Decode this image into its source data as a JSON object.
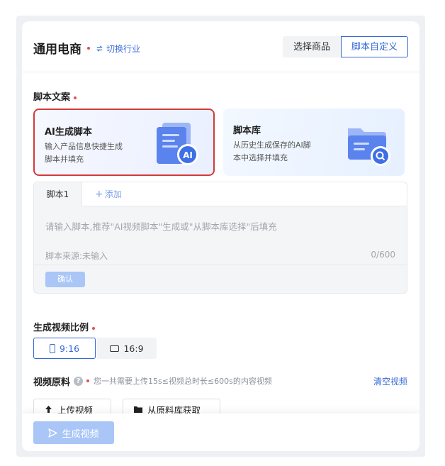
{
  "header": {
    "title": "通用电商",
    "switch_label": "切换行业",
    "seg_select": "选择商品",
    "seg_custom": "脚本自定义"
  },
  "script_section": {
    "label": "脚本文案",
    "ai_card": {
      "title": "AI生成脚本",
      "desc": "输入产品信息快捷生成脚本并填充",
      "badge": "AI"
    },
    "lib_card": {
      "title": "脚本库",
      "desc": "从历史生成保存的AI脚本中选择并填充"
    }
  },
  "editor": {
    "tab_label": "脚本1",
    "add_label": "添加",
    "placeholder": "请输入脚本,推荐\"AI视频脚本\"生成或\"从脚本库选择\"后填充",
    "source": "脚本来源:未输入",
    "count": "0/600",
    "confirm": "确认"
  },
  "ratio_section": {
    "label": "生成视频比例",
    "options": [
      "9:16",
      "16:9"
    ],
    "selected": "9:16"
  },
  "material_section": {
    "label": "视频原料",
    "help": "?",
    "hint": "您一共需要上传15s≤视频总时长≤600s的内容视频",
    "clear": "清空视频",
    "upload_label": "上传视频",
    "library_label": "从原料库获取"
  },
  "footer": {
    "generate_label": "生成视频"
  },
  "colors": {
    "accent": "#3568d4",
    "required": "#e0524f",
    "highlight": "#d33a3a",
    "disabled_btn": "#a9c6f7"
  }
}
